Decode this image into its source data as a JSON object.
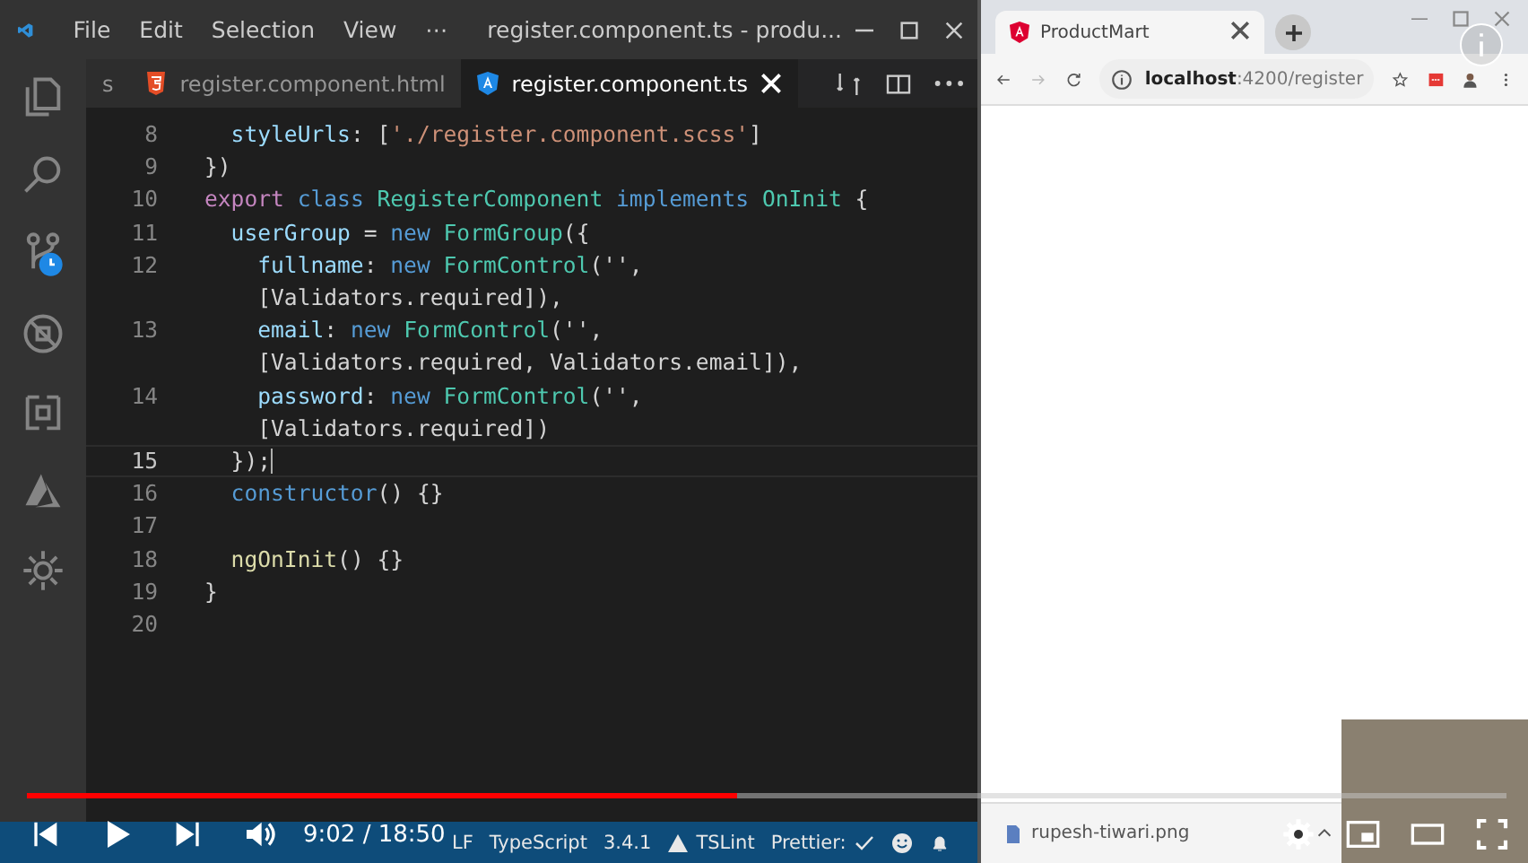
{
  "editor_window": {
    "menu": [
      "File",
      "Edit",
      "Selection",
      "View",
      "⋯"
    ],
    "title": "register.component.ts - produ...",
    "tabs": [
      {
        "label": "s",
        "selected": false
      },
      {
        "label": "register.component.html",
        "selected": false
      },
      {
        "label": "register.component.ts",
        "selected": true
      }
    ],
    "lines": [
      {
        "number": "8",
        "current": false,
        "tokens": [
          {
            "text": "  styleUrls",
            "kind": "prop"
          },
          {
            "text": ": [",
            "kind": "plain"
          },
          {
            "text": "'./register.component.scss'",
            "kind": "str"
          },
          {
            "text": "]",
            "kind": "plain"
          }
        ]
      },
      {
        "number": "9",
        "current": false,
        "tokens": [
          {
            "text": "})",
            "kind": "plain"
          }
        ]
      },
      {
        "number": "10",
        "current": false,
        "tokens": [
          {
            "text": "export",
            "kind": "kw"
          },
          {
            "text": " class ",
            "kind": "storage"
          },
          {
            "text": "RegisterComponent",
            "kind": "type"
          },
          {
            "text": " implements ",
            "kind": "storage"
          },
          {
            "text": "OnInit",
            "kind": "type"
          },
          {
            "text": " {",
            "kind": "plain"
          }
        ]
      },
      {
        "number": "11",
        "current": false,
        "tokens": [
          {
            "text": "  userGroup",
            "kind": "prop"
          },
          {
            "text": " = ",
            "kind": "plain"
          },
          {
            "text": "new",
            "kind": "storage"
          },
          {
            "text": " FormGroup",
            "kind": "type"
          },
          {
            "text": "({",
            "kind": "plain"
          }
        ]
      },
      {
        "number": "12",
        "current": false,
        "tokens": [
          {
            "text": "    fullname",
            "kind": "prop"
          },
          {
            "text": ": ",
            "kind": "plain"
          },
          {
            "text": "new",
            "kind": "storage"
          },
          {
            "text": " FormControl",
            "kind": "type"
          },
          {
            "text": "('',",
            "kind": "plain"
          }
        ]
      },
      {
        "current": false,
        "tokens": [
          {
            "text": "    [Validators.required]),",
            "kind": "plain"
          }
        ]
      },
      {
        "number": "13",
        "current": false,
        "tokens": [
          {
            "text": "    email",
            "kind": "prop"
          },
          {
            "text": ": ",
            "kind": "plain"
          },
          {
            "text": "new",
            "kind": "storage"
          },
          {
            "text": " FormControl",
            "kind": "type"
          },
          {
            "text": "('',",
            "kind": "plain"
          }
        ]
      },
      {
        "current": false,
        "tokens": [
          {
            "text": "    [Validators.required, Validators.email]),",
            "kind": "plain"
          }
        ]
      },
      {
        "number": "14",
        "current": false,
        "tokens": [
          {
            "text": "    password",
            "kind": "prop"
          },
          {
            "text": ": ",
            "kind": "plain"
          },
          {
            "text": "new",
            "kind": "storage"
          },
          {
            "text": " FormControl",
            "kind": "type"
          },
          {
            "text": "('',",
            "kind": "plain"
          }
        ]
      },
      {
        "current": false,
        "tokens": [
          {
            "text": "    [Validators.required])",
            "kind": "plain"
          }
        ]
      },
      {
        "number": "15",
        "current": true,
        "tokens": [
          {
            "text": "  });",
            "kind": "plain"
          }
        ]
      },
      {
        "number": "16",
        "current": false,
        "tokens": [
          {
            "text": "  constructor",
            "kind": "storage"
          },
          {
            "text": "() {}",
            "kind": "plain"
          }
        ]
      },
      {
        "number": "17",
        "current": false
      },
      {
        "number": "18",
        "current": false,
        "tokens": [
          {
            "text": "  ngOnInit",
            "kind": "fn"
          },
          {
            "text": "() {}",
            "kind": "plain"
          }
        ]
      },
      {
        "number": "19",
        "current": false,
        "tokens": [
          {
            "text": "}",
            "kind": "plain"
          }
        ]
      },
      {
        "number": "20",
        "current": false
      }
    ],
    "status_bar": [
      {
        "kind": "text",
        "label": "LF"
      },
      {
        "kind": "text",
        "label": "TypeScript"
      },
      {
        "kind": "text",
        "label": "3.4.1"
      },
      {
        "kind": "warning",
        "label": "TSLint"
      },
      {
        "kind": "check",
        "label": "Prettier:"
      }
    ]
  },
  "browser": {
    "tab": "ProductMart",
    "url_host": "localhost",
    "url_path": ":4200/register",
    "download": "rupesh-tiwari.png"
  },
  "player": {
    "level": 0.48,
    "time": "9:02 / 18:50"
  }
}
